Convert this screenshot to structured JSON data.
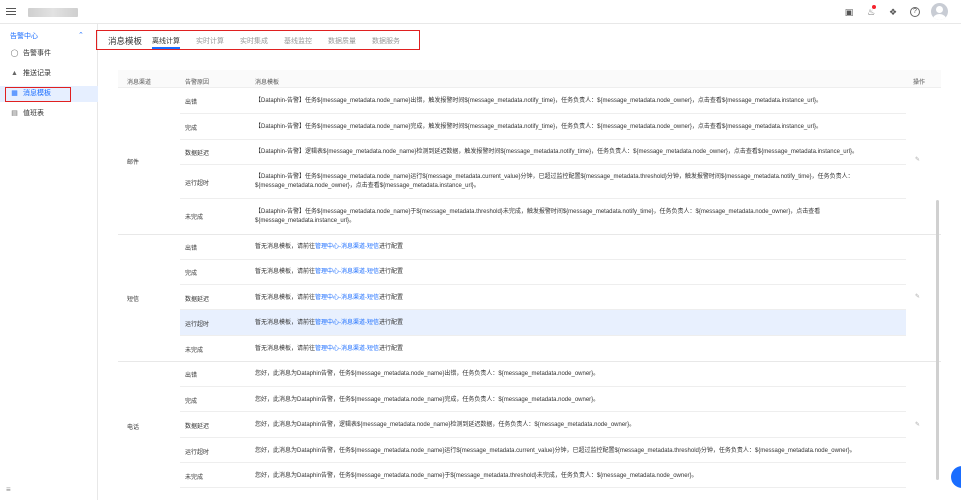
{
  "topbar": {
    "icons": [
      "menu-icon",
      "app-icon",
      "bell-icon",
      "puzzle-icon",
      "help-icon"
    ]
  },
  "sidebar": {
    "group_label": "告警中心",
    "items": [
      {
        "label": "告警事件",
        "icon": "alert-icon"
      },
      {
        "label": "推送记录",
        "icon": "push-icon"
      },
      {
        "label": "消息模板",
        "icon": "template-icon",
        "active": true
      },
      {
        "label": "值班表",
        "icon": "calendar-icon"
      }
    ]
  },
  "tabs": {
    "title": "消息模板",
    "items": [
      "离线计算",
      "实时计算",
      "实时集成",
      "基线监控",
      "数据质量",
      "数据服务"
    ],
    "active_index": 0
  },
  "table": {
    "headers": {
      "channel": "消息渠道",
      "reason": "告警原因",
      "template": "消息模板",
      "action": "操作"
    },
    "groups": [
      {
        "channel": "邮件",
        "rows": [
          {
            "reason": "出错",
            "template": "【Dataphin-告警】任务${message_metadata.node_name}出错，触发报警时间${message_metadata.notify_time}，任务负责人：${message_metadata.node_owner}，点击查看${message_metadata.instance_url}。"
          },
          {
            "reason": "完成",
            "template": "【Dataphin-告警】任务${message_metadata.node_name}完成，触发报警时间${message_metadata.notify_time}，任务负责人：${message_metadata.node_owner}，点击查看${message_metadata.instance_url}。"
          },
          {
            "reason": "数据延迟",
            "template": "【Dataphin-告警】逻辑表${message_metadata.node_name}检测到延迟数据，触发报警时间${message_metadata.notify_time}，任务负责人：${message_metadata.node_owner}，点击查看${message_metadata.instance_url}。"
          },
          {
            "reason": "运行超时",
            "template": "【Dataphin-告警】任务${message_metadata.node_name}运行${message_metadata.current_value}分钟，已超过监控配置${message_metadata.threshold}分钟，触发报警时间${message_metadata.notify_time}，任务负责人：${message_metadata.node_owner}，点击查看${message_metadata.instance_url}。"
          },
          {
            "reason": "未完成",
            "template": "【Dataphin-告警】任务${message_metadata.node_name}于${message_metadata.threshold}未完成，触发报警时间${message_metadata.notify_time}，任务负责人：${message_metadata.node_owner}，点击查看${message_metadata.instance_url}。"
          }
        ]
      },
      {
        "channel": "短信",
        "rows": [
          {
            "reason": "出错",
            "template": "暂无消息模板，请前往",
            "link": "管理中心-消息渠道-短信",
            "suffix": "进行配置"
          },
          {
            "reason": "完成",
            "template": "暂无消息模板，请前往",
            "link": "管理中心-消息渠道-短信",
            "suffix": "进行配置"
          },
          {
            "reason": "数据延迟",
            "template": "暂无消息模板，请前往",
            "link": "管理中心-消息渠道-短信",
            "suffix": "进行配置"
          },
          {
            "reason": "运行超时",
            "template": "暂无消息模板，请前往",
            "link": "管理中心-消息渠道-短信",
            "suffix": "进行配置"
          },
          {
            "reason": "未完成",
            "template": "暂无消息模板，请前往",
            "link": "管理中心-消息渠道-短信",
            "suffix": "进行配置"
          }
        ]
      },
      {
        "channel": "电话",
        "rows": [
          {
            "reason": "出错",
            "template": "您好，此消息为Dataphin告警，任务${message_metadata.node_name}出错，任务负责人：${message_metadata.node_owner}。"
          },
          {
            "reason": "完成",
            "template": "您好，此消息为Dataphin告警，任务${message_metadata.node_name}完成，任务负责人：${message_metadata.node_owner}。"
          },
          {
            "reason": "数据延迟",
            "template": "您好，此消息为Dataphin告警，逻辑表${message_metadata.node_name}检测到延迟数据，任务负责人：${message_metadata.node_owner}。"
          },
          {
            "reason": "运行超时",
            "template": "您好，此消息为Dataphin告警，任务${message_metadata.node_name}运行${message_metadata.current_value}分钟，已超过监控配置${message_metadata.threshold}分钟，任务负责人：${message_metadata.node_owner}。"
          },
          {
            "reason": "未完成",
            "template": "您好，此消息为Dataphin告警，任务${message_metadata.node_name}于${message_metadata.threshold}未完成，任务负责人：${message_metadata.node_owner}。"
          }
        ]
      }
    ]
  },
  "colors": {
    "accent": "#1a6dff",
    "annotation_red": "#e02020",
    "highlight_row": "#e8f0fe"
  }
}
